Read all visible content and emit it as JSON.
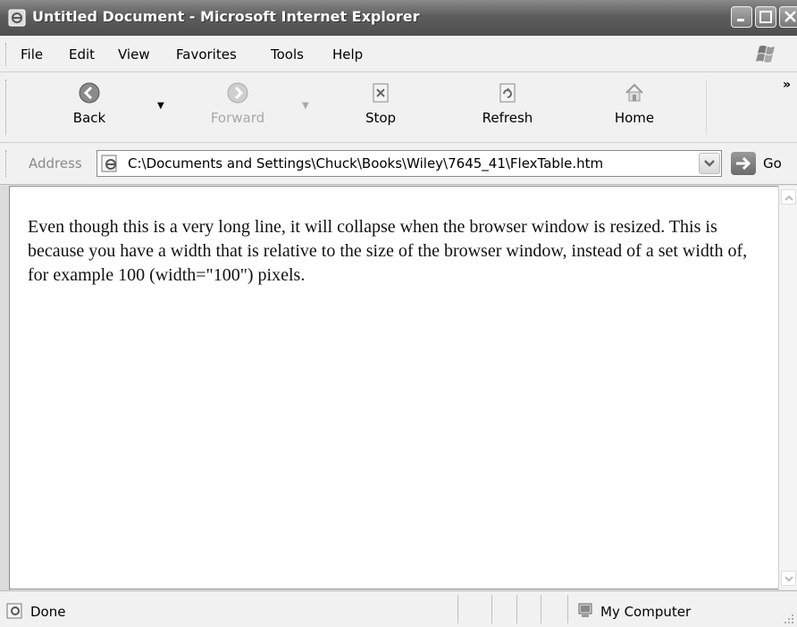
{
  "window": {
    "title": "Untitled Document - Microsoft Internet Explorer"
  },
  "menu": {
    "items": [
      "File",
      "Edit",
      "View",
      "Favorites",
      "Tools",
      "Help"
    ]
  },
  "toolbar": {
    "back_label": "Back",
    "forward_label": "Forward",
    "stop_label": "Stop",
    "refresh_label": "Refresh",
    "home_label": "Home",
    "more_label": "»"
  },
  "address": {
    "label": "Address",
    "url": "C:\\Documents and Settings\\Chuck\\Books\\Wiley\\7645_41\\FlexTable.htm",
    "go_label": "Go"
  },
  "content": {
    "text": "Even though this is a very long line, it will collapse when the browser window is resized. This is because you have a width that is relative to the size of the browser window, instead of a set width of, for example 100 (width=\"100\") pixels."
  },
  "status": {
    "text": "Done",
    "zone": "My Computer"
  },
  "icons": [
    "ie-icon",
    "minimize-icon",
    "maximize-icon",
    "close-icon",
    "windows-logo-icon",
    "back-arrow-icon",
    "forward-arrow-icon",
    "stop-icon",
    "refresh-icon",
    "home-icon",
    "page-icon",
    "go-arrow-icon",
    "computer-icon"
  ]
}
